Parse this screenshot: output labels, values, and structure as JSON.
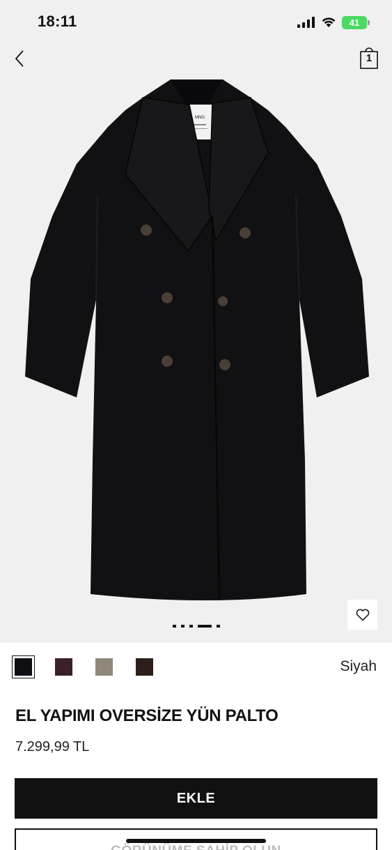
{
  "status_bar": {
    "time": "18:11",
    "battery": "41"
  },
  "header": {
    "back_icon": "chevron-left-icon",
    "bag_icon": "shopping-bag-icon",
    "bag_count": "1"
  },
  "gallery": {
    "label_brand": "MNG",
    "dot_count": 5,
    "active_dot": 3
  },
  "colors": {
    "swatches": [
      "#0f0f14",
      "#3a2127",
      "#8f887a",
      "#2d1e19"
    ],
    "selected_index": 0,
    "selected_name": "Siyah"
  },
  "product": {
    "title": "EL YAPIMI OVERSİZE YÜN PALTO",
    "price": "7.299,99 TL"
  },
  "actions": {
    "add_label": "EKLE",
    "look_label": "GÖRÜNÜME SAHİP OLUN"
  }
}
